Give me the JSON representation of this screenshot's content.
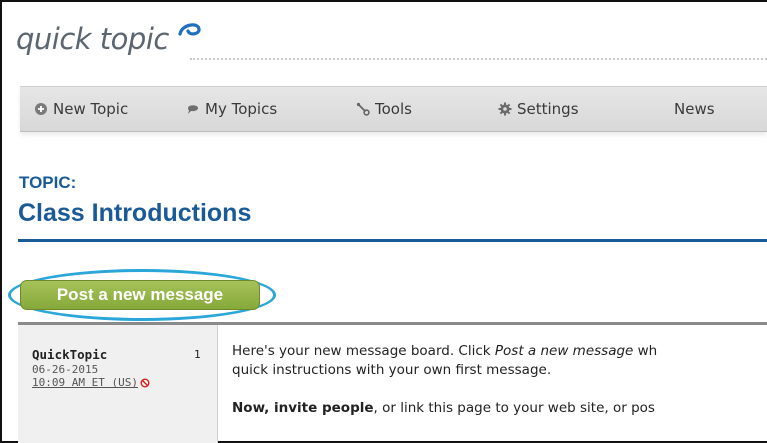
{
  "logo": {
    "text": "quick topic"
  },
  "nav": [
    {
      "label": "New Topic",
      "icon": "plus-circle-icon"
    },
    {
      "label": "My Topics",
      "icon": "chat-bubble-icon"
    },
    {
      "label": "Tools",
      "icon": "wrench-icon"
    },
    {
      "label": "Settings",
      "icon": "gear-icon"
    },
    {
      "label": "News",
      "icon": ""
    }
  ],
  "topic": {
    "label": "TOPIC:",
    "title": "Class Introductions"
  },
  "post_button": {
    "label": "Post a new message"
  },
  "message": {
    "author": "QuickTopic",
    "number": "1",
    "date": "06-26-2015",
    "time": "10:09 AM ET (US)",
    "body_line1_pre": "Here's your new message board. Click ",
    "body_line1_em": "Post a new message",
    "body_line1_post": " wh",
    "body_line2": "quick instructions with your own first message.",
    "body_line3_bold": "Now, invite people",
    "body_line3_rest": ", or link this page to your web site, or pos"
  },
  "colors": {
    "heading": "#1a5a96",
    "button": "#94b446",
    "highlight_oval": "#2aa6d8"
  }
}
